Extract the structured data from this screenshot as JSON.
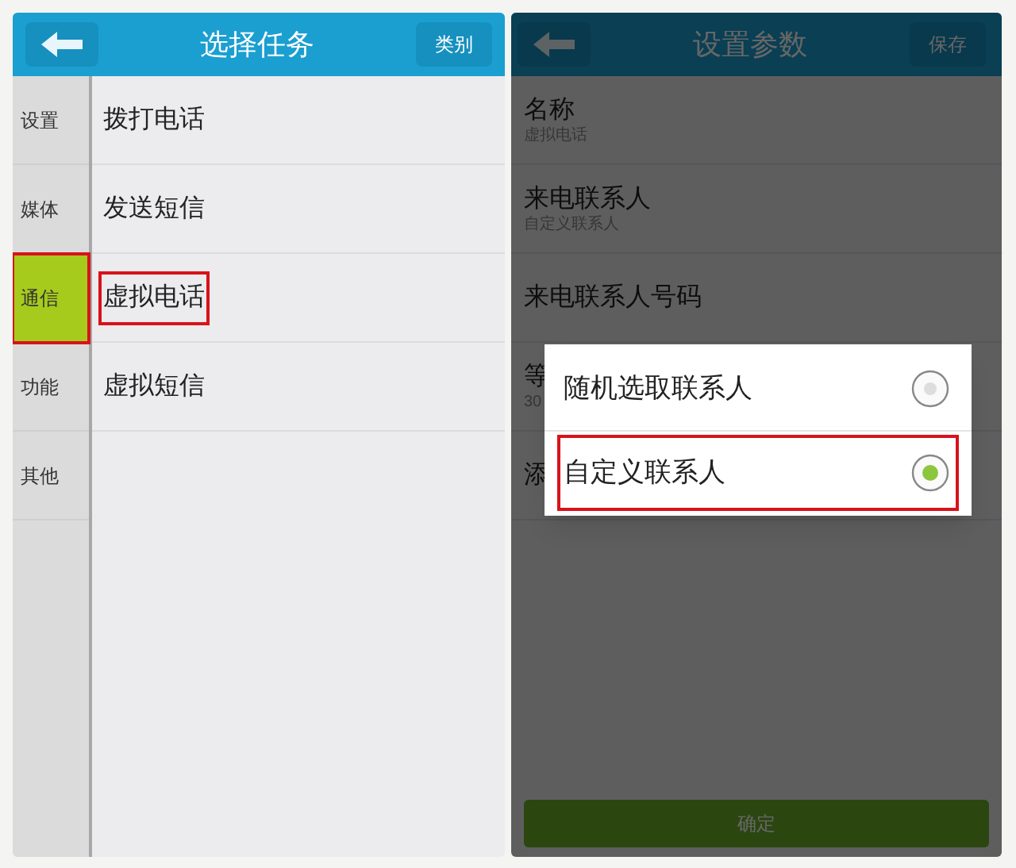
{
  "task_screen": {
    "title": "选择任务",
    "category_button": "类别",
    "categories": [
      {
        "label": "设置",
        "selected": false,
        "highlighted": false
      },
      {
        "label": "媒体",
        "selected": false,
        "highlighted": false
      },
      {
        "label": "通信",
        "selected": true,
        "highlighted": true
      },
      {
        "label": "功能",
        "selected": false,
        "highlighted": false
      },
      {
        "label": "其他",
        "selected": false,
        "highlighted": false
      }
    ],
    "tasks": [
      {
        "label": "拨打电话",
        "highlighted": false
      },
      {
        "label": "发送短信",
        "highlighted": false
      },
      {
        "label": "虚拟电话",
        "highlighted": true
      },
      {
        "label": "虚拟短信",
        "highlighted": false
      }
    ]
  },
  "settings_screen": {
    "title": "设置参数",
    "save_button": "保存",
    "rows": [
      {
        "label": "名称",
        "value": "虚拟电话"
      },
      {
        "label": "来电联系人",
        "value": "自定义联系人"
      },
      {
        "label": "来电联系人号码"
      },
      {
        "label": "等",
        "value": "30"
      },
      {
        "label": "添"
      }
    ],
    "confirm_button": "确定",
    "dialog": {
      "options": [
        {
          "label": "随机选取联系人",
          "selected": false,
          "highlighted": false
        },
        {
          "label": "自定义联系人",
          "selected": true,
          "highlighted": true
        }
      ]
    }
  }
}
